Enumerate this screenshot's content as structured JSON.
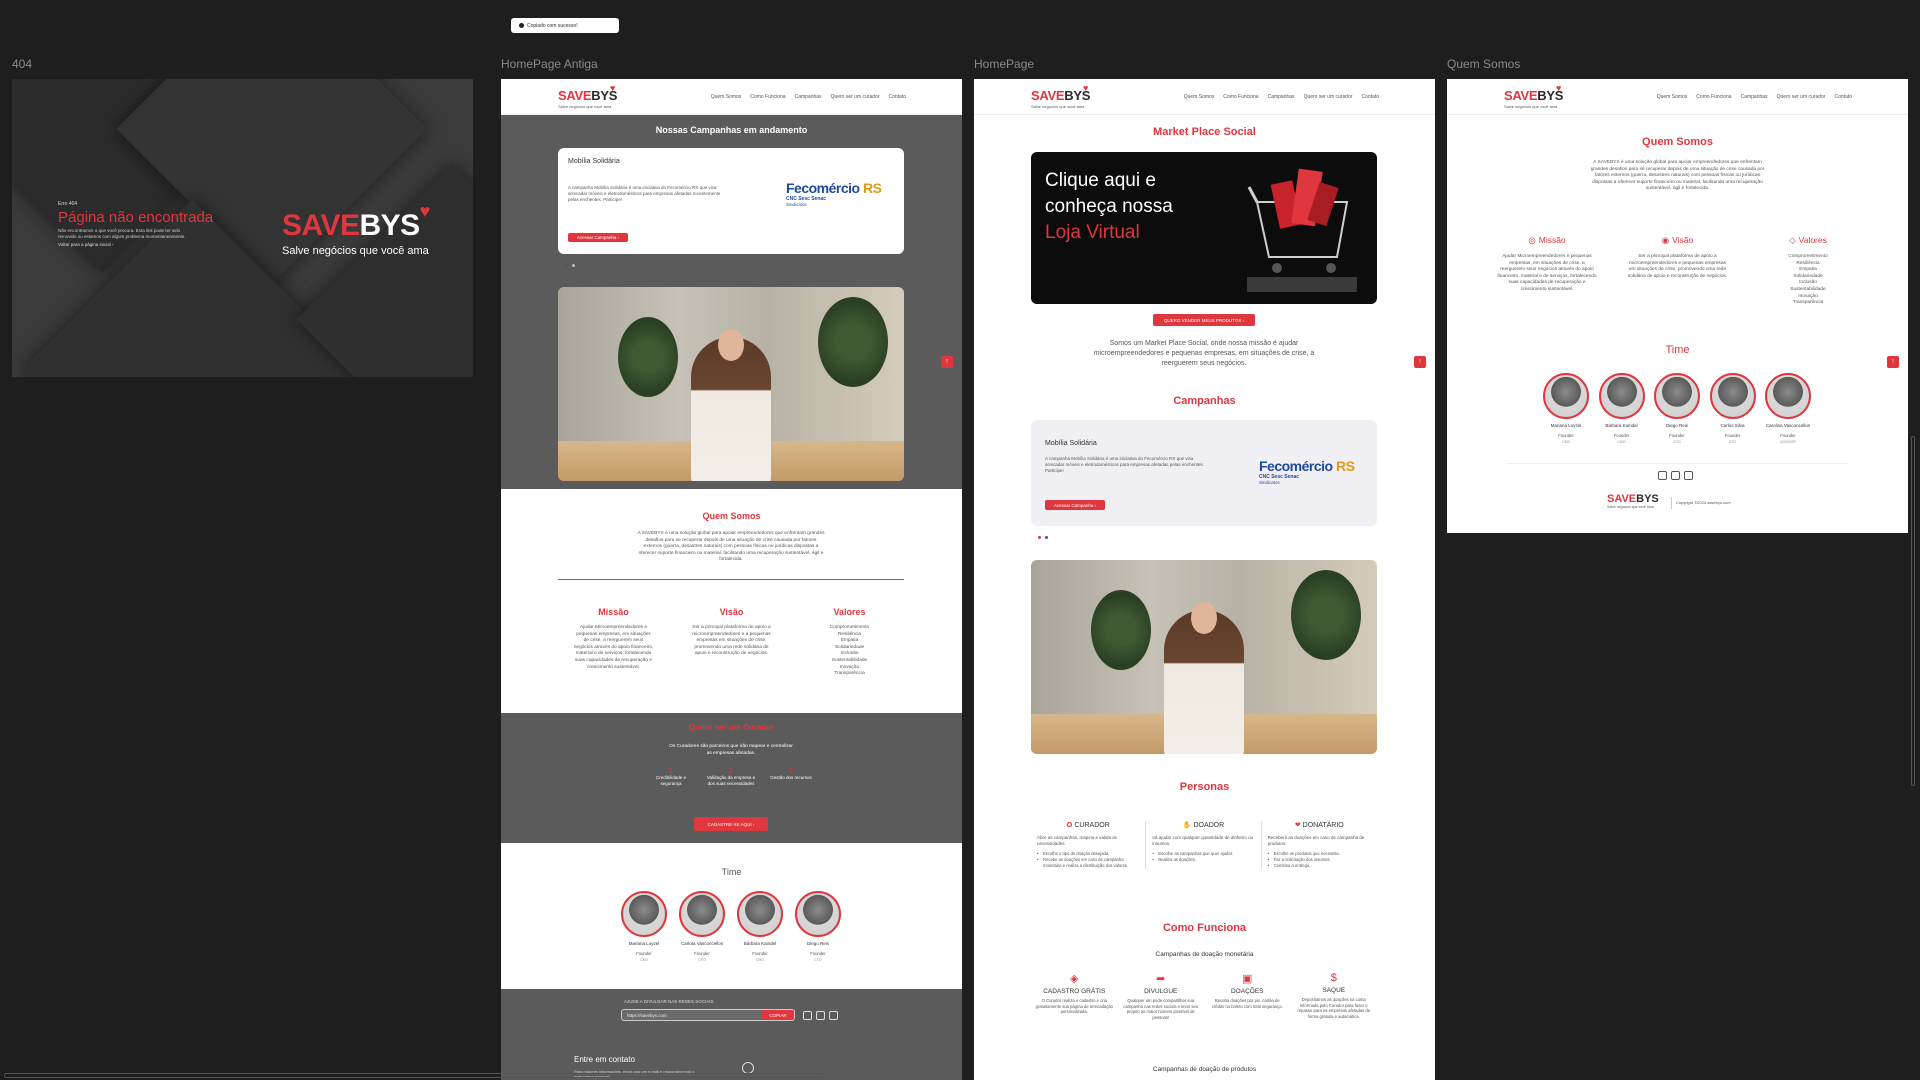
{
  "toast": {
    "text": "Copiado com sucesso!"
  },
  "frames": {
    "f404": "404",
    "antiga": "HomePage Antiga",
    "home": "HomePage",
    "quem": "Quem Somos"
  },
  "brand": {
    "savebys_a": "SAVE",
    "savebys_b": "BYS",
    "tagline": "Salve negócios que você ama",
    "heart": "♥"
  },
  "nav": [
    "Quem Somos",
    "Como Funciona",
    "Campanhas",
    "Quero ser um curador",
    "Contato"
  ],
  "p404": {
    "code": "Erro 404",
    "title": "Página não encontrada",
    "desc": "Não encontramos o que você procura. Esta link pode ter sido removido ou estamos com algum problema momentaneamente.",
    "link": "Voltar para a página inicial ›"
  },
  "antiga": {
    "campaigns_title": "Nossas Campanhas em andamento",
    "card_title": "Mobília Solidária",
    "card_desc": "A campanha Mobília Solidária é uma iniciativa do Fecomércio RS que visa arrecadar móveis e eletrodomésticos para empresas afetadas recentemente pelas enchentes. Participe!",
    "card_btn": "Acessar Campanha ›",
    "quem_title": "Quem Somos",
    "quem_desc": "A SAVEBYS é uma solução global para apoiar empreendedores que enfrentam grandes desafios para se recuperar depois de uma situação de crise causada por fatores externos (guerra, desastres naturais) com pessoas físicas ou jurídicas dispostas a oferecer suporte financeiro ou material, facilitando uma recuperação sustentável, ágil e fortalecida.",
    "missao": "Missão",
    "missao_desc": "Ajudar Microempreendedores e pequenas empresas, em situações de crise, a reerguerem seus negócios através do apoio financeiro, material e de serviços, fortalecendo suas capacidades de recuperação e crescimento sustentável.",
    "visao": "Visão",
    "visao_desc": "Ser a principal plataforma de apoio a microempreendedores e a pequenas empresas em situações de crise, promovendo uma rede solidária de apoio e reconstrução de negócios.",
    "valores": "Valores",
    "valores_list": [
      "Comprometimento",
      "Resiliência",
      "Empatia",
      "Solidariedade",
      "Inclusão",
      "Sustentabilidade",
      "Inovação",
      "Transparência"
    ],
    "curador_title": "Quero ser um Curador",
    "curador_desc": "Os Curadores são parceiros que irão mapear e centralizar as empresas afetadas.",
    "steps": [
      {
        "n": "1",
        "t": "Credibilidade e segurança"
      },
      {
        "n": "2",
        "t": "Validação da empresa e dos suas necessidades"
      },
      {
        "n": "3",
        "t": "Gestão dos recursos"
      }
    ],
    "curador_btn": "CADASTRE-SE AQUI ›",
    "time_title": "Time",
    "team": [
      {
        "name": "Mariana Loyzel",
        "role": "Founder",
        "sub": "CEO"
      },
      {
        "name": "Carlota Vasconcellos",
        "role": "Founder",
        "sub": "CFO"
      },
      {
        "name": "Bárbara Kaindel",
        "role": "Founder",
        "sub": "CMO"
      },
      {
        "name": "Diego Reis",
        "role": "Founder",
        "sub": "CTO"
      }
    ],
    "share_label": "AJUDE A DIVULGAR NAS REDES SOCIAIS",
    "share_value": "https://savebys.com",
    "share_btn": "COPIAR",
    "contact_title": "Entre em contato",
    "contact_desc": "Para maiores informações, envie-nos um e-mail e responderemos o mais breve possível."
  },
  "home": {
    "market_title": "Market Place Social",
    "banner_line1": "Clique aqui e",
    "banner_line2": "conheça nossa",
    "banner_line3": "Loja Virtual",
    "banner_btn": "QUERO VENDER MEUS PRODUTOS ›",
    "market_desc": "Somos um Market Place Social, onde nossa missão é ajudar microempreendedores e pequenas empresas, em situações de crise, a reerguerem seus negócios.",
    "camp_title": "Campanhas",
    "card_title": "Mobília Solidária",
    "card_desc": "A campanha Mobília Solidária é uma iniciativa do Fecomércio RS que visa arrecadar móveis e eletrodomésticos para empresas afetadas pelas enchentes. Participe!",
    "card_btn": "Acessar Campanha ›",
    "personas_title": "Personas",
    "personas": [
      {
        "t": "CURADOR",
        "d": "Abre as campanhas, mapeia e valida as necessidades.",
        "b": [
          "Escolhe o tipo de doação desejada.",
          "Recebe as doações em caso de campanha monetária e realiza a distribuição dos valores."
        ]
      },
      {
        "t": "DOADOR",
        "d": "Irá ajudar com qualquer quantidade de dinheiro ou insumos.",
        "b": [
          "Escolhe as campanhas que quer ajudar.",
          "Realiza as doações."
        ]
      },
      {
        "t": "DONATÁRIO",
        "d": "Receberá as doações em caso de campanha de produtos.",
        "b": [
          "Escolhe os produtos que necessita.",
          "Faz a solicitação dos insumos.",
          "Combina a entrega."
        ]
      }
    ],
    "how_title": "Como Funciona",
    "how_sub1": "Campanhas de doação monetária",
    "how": [
      {
        "t": "CADASTRO GRÁTIS",
        "d": "O Curador realiza o cadastro e cria gratuitamente sua página de arrecadação personalizada."
      },
      {
        "t": "DIVULGUE",
        "d": "Qualquer um pode compartilhar sua campanha nas redes sociais e levar seu projeto ao maior número possível de pessoas!"
      },
      {
        "t": "DOAÇÕES",
        "d": "Receba doações por pix, cartão de crédito ou boleto com total segurança."
      },
      {
        "t": "SAQUE",
        "d": "Depositamos as doações na conta informada pelo Curador para fazer o repasse para os empresas afetadas de forma gratuita e automática."
      }
    ],
    "how_sub2": "Campanhas de doação de produtos"
  },
  "quem": {
    "title": "Quem Somos",
    "desc": "A SAVEBYS é uma solução global para apoiar empreendedores que enfrentam grandes desafios para se recuperar depois de uma situação de crise causada por fatores externos (guerra, desastres naturais) com pessoas físicas ou jurídicas dispostas a oferecer suporte financeiro ou material, facilitando uma recuperação sustentável, ágil e fortalecida.",
    "missao": "Missão",
    "missao_desc": "Ajudar Microempreendedores e pequenas empresas, em situações de crise, a reerguerem seus negócios através do apoio financeiro, material e de serviços, fortalecendo suas capacidades de recuperação e crescimento sustentável.",
    "visao": "Visão",
    "visao_desc": "Ser a principal plataforma de apoio a microempreendedores e pequenas empresas em situações de crise, promovendo uma rede solidária de apoio e reconstrução de negócios.",
    "valores": "Valores",
    "valores_list": [
      "Comprometimento",
      "Resiliência",
      "Empatia",
      "Solidariedade",
      "Inclusão",
      "Sustentabilidade",
      "Inovação",
      "Transparência"
    ],
    "time_title": "Time",
    "team": [
      {
        "name": "Mariana Loyzel",
        "role": "Founder",
        "sub": "CEO"
      },
      {
        "name": "Bárbara Kaindel",
        "role": "Founder",
        "sub": "CMO"
      },
      {
        "name": "Diego Reis",
        "role": "Founder",
        "sub": "CTO"
      },
      {
        "name": "Carlos Silva",
        "role": "Founder",
        "sub": "CTO"
      },
      {
        "name": "Carolina Vasconcellos",
        "role": "Founder",
        "sub": "ADVISOR"
      }
    ],
    "copyright": "Copyright ©2024 savebys.com"
  },
  "fecomercio": {
    "a": "Fecomércio",
    "b": "RS",
    "sub": "CNC Sesc Senac",
    "sind": "Sindicatos"
  },
  "icons": {
    "up": "↑",
    "arrow": "›"
  },
  "colors": {
    "accent": "#e0363d",
    "dark": "#5b5b5b",
    "canvas": "#1e1e1e"
  }
}
